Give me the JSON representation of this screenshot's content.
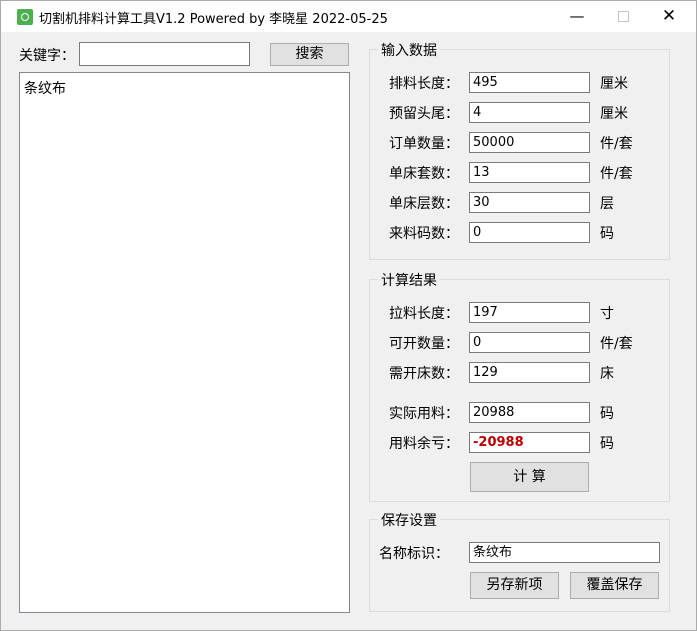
{
  "window": {
    "title": "切割机排料计算工具V1.2 Powered by 李晓星 2022-05-25",
    "minimize_glyph": "—",
    "close_glyph": "✕"
  },
  "search": {
    "label": "关键字：",
    "value": "",
    "button": "搜索"
  },
  "list": {
    "items": [
      "条纹布"
    ]
  },
  "input_group": {
    "title": "输入数据",
    "fields": [
      {
        "label": "排料长度：",
        "value": "495",
        "unit": "厘米"
      },
      {
        "label": "预留头尾：",
        "value": "4",
        "unit": "厘米"
      },
      {
        "label": "订单数量：",
        "value": "50000",
        "unit": "件/套"
      },
      {
        "label": "单床套数：",
        "value": "13",
        "unit": "件/套"
      },
      {
        "label": "单床层数：",
        "value": "30",
        "unit": "层"
      },
      {
        "label": "来料码数：",
        "value": "0",
        "unit": "码"
      }
    ]
  },
  "result_group": {
    "title": "计算结果",
    "fields": [
      {
        "label": "拉料长度：",
        "value": "197",
        "unit": "寸"
      },
      {
        "label": "可开数量：",
        "value": "0",
        "unit": "件/套"
      },
      {
        "label": "需开床数：",
        "value": "129",
        "unit": "床"
      },
      {
        "label": "实际用料：",
        "value": "20988",
        "unit": "码"
      },
      {
        "label": "用料余亏：",
        "value": "-20988",
        "unit": "码"
      }
    ],
    "calc_button": "计  算",
    "negative_color": "#c00000"
  },
  "save_group": {
    "title": "保存设置",
    "name_label": "名称标识：",
    "name_value": "条纹布",
    "save_new_button": "另存新项",
    "overwrite_button": "覆盖保存"
  }
}
